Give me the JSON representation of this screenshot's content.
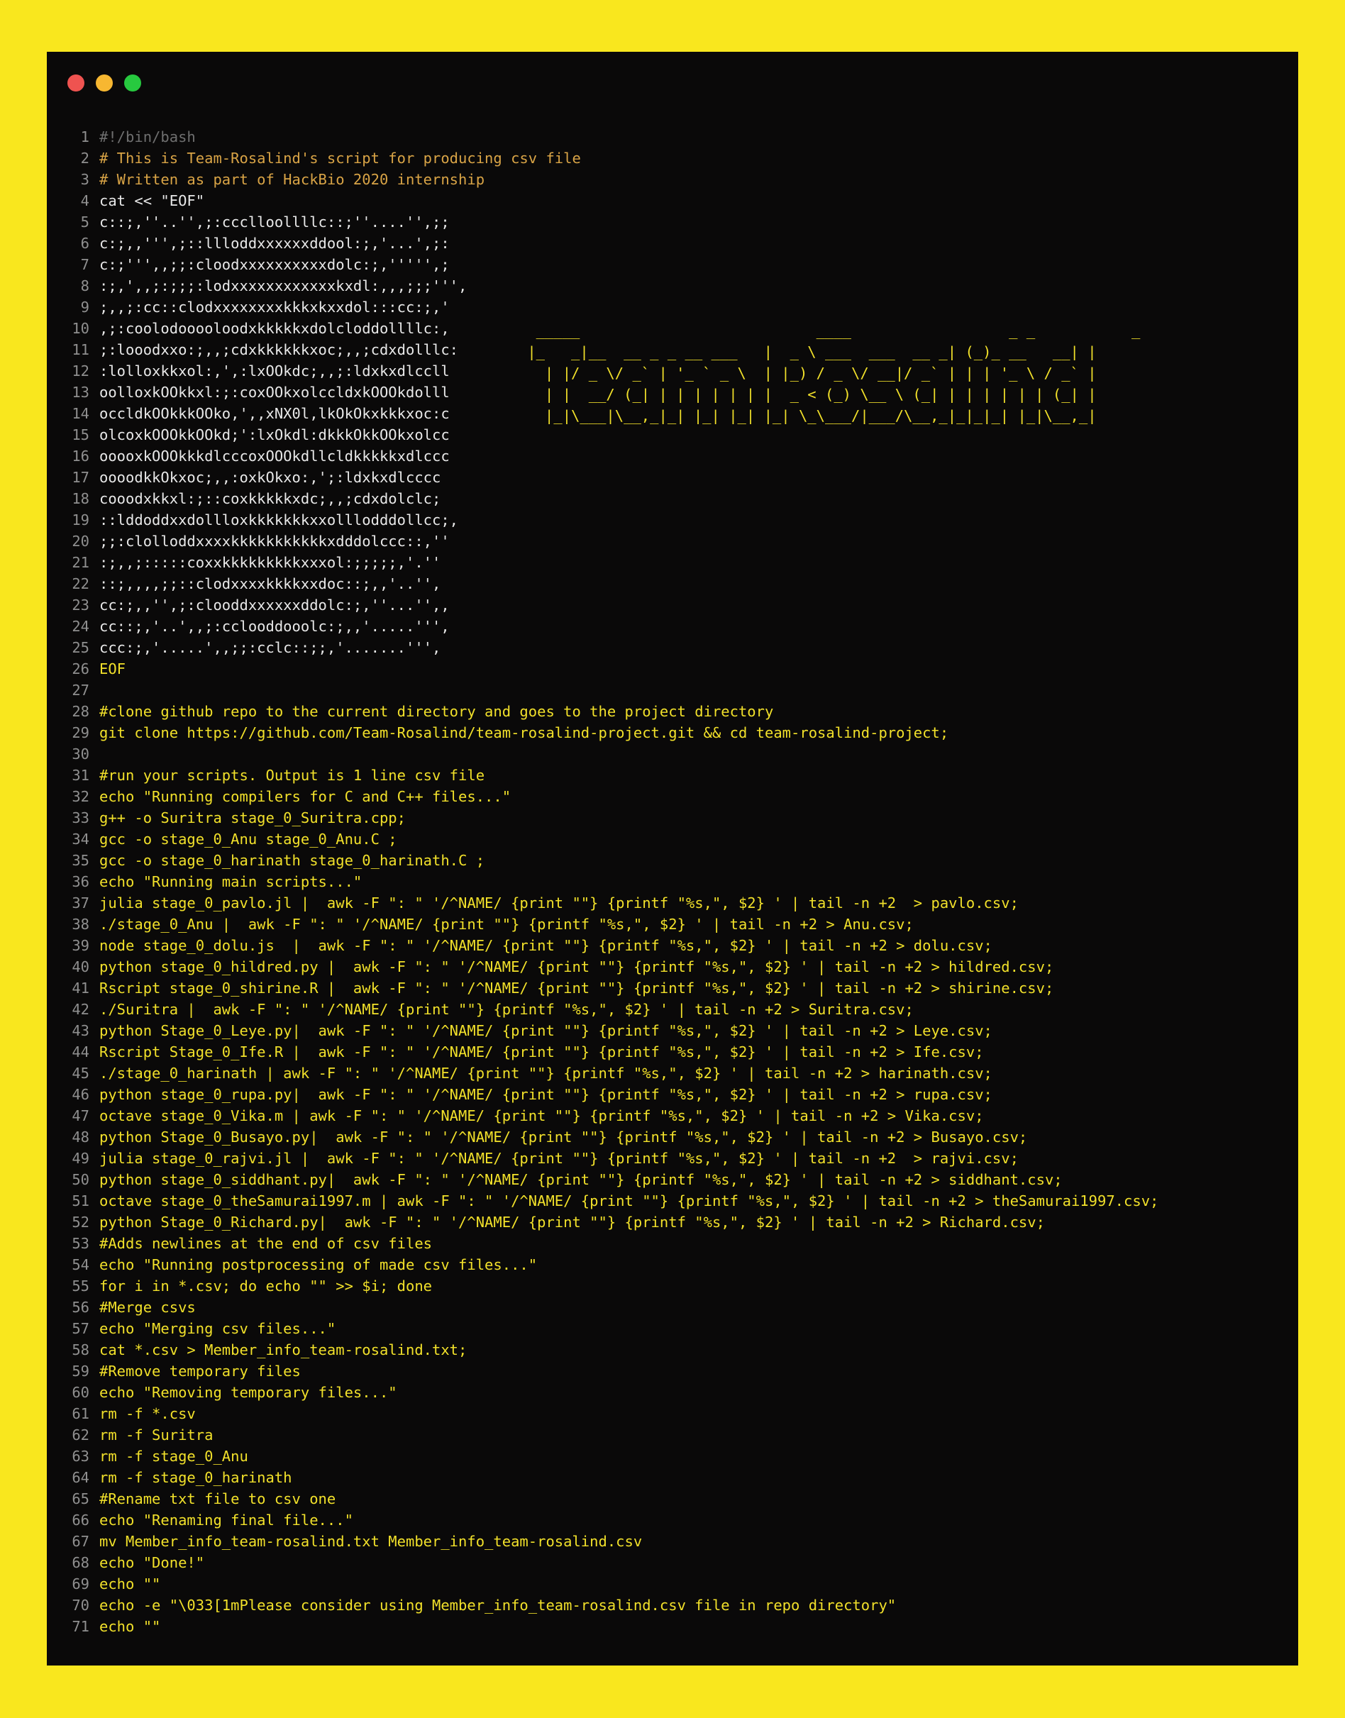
{
  "theme": {
    "background": "#f9e71e",
    "window_background": "#0a0909",
    "code_color": "#f1e02a",
    "comment_color": "#d9a446",
    "ascii_art_color": "#e8e8e8",
    "line_number_color": "#8f8f8f",
    "traffic_lights": [
      "#ef5350",
      "#f7b731",
      "#27c93f"
    ]
  },
  "banner_lines": [
    "  _____                           ____                  _ _           _",
    " |_   _|__  __ _ _ __ ___   |  _ \\ ___  ___  __ _| (_)_ __   __| |",
    "   | |/ _ \\/ _` | '_ ` _ \\  | |_) / _ \\/ __|/ _` | | | '_ \\ / _` |",
    "   | |  __/ (_| | | | | | | |  _ < (_) \\__ \\ (_| | | | | | | (_| |",
    "   |_|\\___|\\__,_|_| |_| |_| |_| \\_\\___/|___/\\__,_|_|_|_| |_|\\__,_|"
  ],
  "lines": [
    {
      "n": "1",
      "t": "#!/bin/bash",
      "s": "shebang"
    },
    {
      "n": "2",
      "t": "# This is Team-Rosalind's script for producing csv file",
      "s": "comment-orange"
    },
    {
      "n": "3",
      "t": "# Written as part of HackBio 2020 internship",
      "s": "comment-orange"
    },
    {
      "n": "4",
      "t": "cat << \"EOF\"",
      "s": "white"
    },
    {
      "n": "5",
      "t": "c::;,''..'',;:ccclloollllc::;''....'',;;",
      "s": "white"
    },
    {
      "n": "6",
      "t": "c:;,,''',;::llloddxxxxxxddool:;,'...',;:",
      "s": "white"
    },
    {
      "n": "7",
      "t": "c:;''',,;;:cloodxxxxxxxxxxdolc:;,''''',;",
      "s": "white"
    },
    {
      "n": "8",
      "t": ":;,',,;:;;;:lodxxxxxxxxxxxxkxdl:,,,;;;''',",
      "s": "white"
    },
    {
      "n": "9",
      "t": ";,,;:cc::clodxxxxxxxxkkkxkxxdol:::cc:;,'",
      "s": "white"
    },
    {
      "n": "10",
      "t": ",;:coolodooooloodxkkkkkxdolcloddollllc:,",
      "s": "white"
    },
    {
      "n": "11",
      "t": ";:looodxxo:;,,;cdxkkkkkkxoc;,,;cdxdolllc:",
      "s": "white"
    },
    {
      "n": "12",
      "t": ":lolloxkkxol:,',:lxOOkdc;,,;:ldxkxdlccll",
      "s": "white"
    },
    {
      "n": "13",
      "t": "oolloxkOOkkxl:;:coxOOkxolccldxkOOOkdolll",
      "s": "white"
    },
    {
      "n": "14",
      "t": "occldkOOkkkOOko,',,xNX0l,lkOkOkxkkkxoc:c",
      "s": "white"
    },
    {
      "n": "15",
      "t": "olcoxkOOOkkOOkd;':lxOkdl:dkkkOkkOOkxolcc",
      "s": "white"
    },
    {
      "n": "16",
      "t": "ooooxkOOOkkkdlcccoxOOOkdllcldkkkkkxdlccc",
      "s": "white"
    },
    {
      "n": "17",
      "t": "oooodkkOkxoc;,,:oxkOkxo:,';:ldxkxdlcccc",
      "s": "white"
    },
    {
      "n": "18",
      "t": "cooodxkkxl:;::coxkkkkkxdc;,,;cdxdolclc;",
      "s": "white"
    },
    {
      "n": "19",
      "t": "::lddoddxxdollloxkkkkkkkxxolllodddollcc;,",
      "s": "white"
    },
    {
      "n": "20",
      "t": ";;:clolloddxxxxkkkkkkkkkkkxdddolccc::,''",
      "s": "white"
    },
    {
      "n": "21",
      "t": ":;,,;:::::coxxkkkkkkkkkxxxol:;;;;;,'.''",
      "s": "white"
    },
    {
      "n": "22",
      "t": "::;,,,,;;::clodxxxxkkkkxxdoc::;,,'..'',",
      "s": "white"
    },
    {
      "n": "23",
      "t": "cc:;,,'',;:clooddxxxxxxddolc:;,''...'',,",
      "s": "white"
    },
    {
      "n": "24",
      "t": "cc::;,'..',,;:cclooddooolc:;,,'.....''',",
      "s": "white"
    },
    {
      "n": "25",
      "t": "ccc:;,'.....',,;;:cclc::;;,'.......''',",
      "s": "white"
    },
    {
      "n": "26",
      "t": "EOF",
      "s": ""
    },
    {
      "n": "27",
      "t": "",
      "s": ""
    },
    {
      "n": "28",
      "t": "#clone github repo to the current directory and goes to the project directory",
      "s": ""
    },
    {
      "n": "29",
      "t": "git clone https://github.com/Team-Rosalind/team-rosalind-project.git && cd team-rosalind-project;",
      "s": ""
    },
    {
      "n": "30",
      "t": "",
      "s": ""
    },
    {
      "n": "31",
      "t": "#run your scripts. Output is 1 line csv file",
      "s": ""
    },
    {
      "n": "32",
      "t": "echo \"Running compilers for C and C++ files...\"",
      "s": ""
    },
    {
      "n": "33",
      "t": "g++ -o Suritra stage_0_Suritra.cpp;",
      "s": ""
    },
    {
      "n": "34",
      "t": "gcc -o stage_0_Anu stage_0_Anu.C ;",
      "s": ""
    },
    {
      "n": "35",
      "t": "gcc -o stage_0_harinath stage_0_harinath.C ;",
      "s": ""
    },
    {
      "n": "36",
      "t": "echo \"Running main scripts...\"",
      "s": ""
    },
    {
      "n": "37",
      "t": "julia stage_0_pavlo.jl |  awk -F \": \" '/^NAME/ {print \"\"} {printf \"%s,\", $2} ' | tail -n +2  > pavlo.csv;",
      "s": ""
    },
    {
      "n": "38",
      "t": "./stage_0_Anu |  awk -F \": \" '/^NAME/ {print \"\"} {printf \"%s,\", $2} ' | tail -n +2 > Anu.csv;",
      "s": ""
    },
    {
      "n": "39",
      "t": "node stage_0_dolu.js  |  awk -F \": \" '/^NAME/ {print \"\"} {printf \"%s,\", $2} ' | tail -n +2 > dolu.csv;",
      "s": ""
    },
    {
      "n": "40",
      "t": "python stage_0_hildred.py |  awk -F \": \" '/^NAME/ {print \"\"} {printf \"%s,\", $2} ' | tail -n +2 > hildred.csv;",
      "s": ""
    },
    {
      "n": "41",
      "t": "Rscript stage_0_shirine.R |  awk -F \": \" '/^NAME/ {print \"\"} {printf \"%s,\", $2} ' | tail -n +2 > shirine.csv;",
      "s": ""
    },
    {
      "n": "42",
      "t": "./Suritra |  awk -F \": \" '/^NAME/ {print \"\"} {printf \"%s,\", $2} ' | tail -n +2 > Suritra.csv;",
      "s": ""
    },
    {
      "n": "43",
      "t": "python Stage_0_Leye.py|  awk -F \": \" '/^NAME/ {print \"\"} {printf \"%s,\", $2} ' | tail -n +2 > Leye.csv;",
      "s": ""
    },
    {
      "n": "44",
      "t": "Rscript Stage_0_Ife.R |  awk -F \": \" '/^NAME/ {print \"\"} {printf \"%s,\", $2} ' | tail -n +2 > Ife.csv;",
      "s": ""
    },
    {
      "n": "45",
      "t": "./stage_0_harinath | awk -F \": \" '/^NAME/ {print \"\"} {printf \"%s,\", $2} ' | tail -n +2 > harinath.csv;",
      "s": ""
    },
    {
      "n": "46",
      "t": "python stage_0_rupa.py|  awk -F \": \" '/^NAME/ {print \"\"} {printf \"%s,\", $2} ' | tail -n +2 > rupa.csv;",
      "s": ""
    },
    {
      "n": "47",
      "t": "octave stage_0_Vika.m | awk -F \": \" '/^NAME/ {print \"\"} {printf \"%s,\", $2} ' | tail -n +2 > Vika.csv;",
      "s": ""
    },
    {
      "n": "48",
      "t": "python Stage_0_Busayo.py|  awk -F \": \" '/^NAME/ {print \"\"} {printf \"%s,\", $2} ' | tail -n +2 > Busayo.csv;",
      "s": ""
    },
    {
      "n": "49",
      "t": "julia stage_0_rajvi.jl |  awk -F \": \" '/^NAME/ {print \"\"} {printf \"%s,\", $2} ' | tail -n +2  > rajvi.csv;",
      "s": ""
    },
    {
      "n": "50",
      "t": "python stage_0_siddhant.py|  awk -F \": \" '/^NAME/ {print \"\"} {printf \"%s,\", $2} ' | tail -n +2 > siddhant.csv;",
      "s": ""
    },
    {
      "n": "51",
      "t": "octave stage_0_theSamurai1997.m | awk -F \": \" '/^NAME/ {print \"\"} {printf \"%s,\", $2} ' | tail -n +2 > theSamurai1997.csv;",
      "s": ""
    },
    {
      "n": "52",
      "t": "python Stage_0_Richard.py|  awk -F \": \" '/^NAME/ {print \"\"} {printf \"%s,\", $2} ' | tail -n +2 > Richard.csv;",
      "s": ""
    },
    {
      "n": "53",
      "t": "#Adds newlines at the end of csv files",
      "s": ""
    },
    {
      "n": "54",
      "t": "echo \"Running postprocessing of made csv files...\"",
      "s": ""
    },
    {
      "n": "55",
      "t": "for i in *.csv; do echo \"\" >> $i; done",
      "s": ""
    },
    {
      "n": "56",
      "t": "#Merge csvs",
      "s": ""
    },
    {
      "n": "57",
      "t": "echo \"Merging csv files...\"",
      "s": ""
    },
    {
      "n": "58",
      "t": "cat *.csv > Member_info_team-rosalind.txt;",
      "s": ""
    },
    {
      "n": "59",
      "t": "#Remove temporary files",
      "s": ""
    },
    {
      "n": "60",
      "t": "echo \"Removing temporary files...\"",
      "s": ""
    },
    {
      "n": "61",
      "t": "rm -f *.csv",
      "s": ""
    },
    {
      "n": "62",
      "t": "rm -f Suritra",
      "s": ""
    },
    {
      "n": "63",
      "t": "rm -f stage_0_Anu",
      "s": ""
    },
    {
      "n": "64",
      "t": "rm -f stage_0_harinath",
      "s": ""
    },
    {
      "n": "65",
      "t": "#Rename txt file to csv one",
      "s": ""
    },
    {
      "n": "66",
      "t": "echo \"Renaming final file...\"",
      "s": ""
    },
    {
      "n": "67",
      "t": "mv Member_info_team-rosalind.txt Member_info_team-rosalind.csv",
      "s": ""
    },
    {
      "n": "68",
      "t": "echo \"Done!\"",
      "s": ""
    },
    {
      "n": "69",
      "t": "echo \"\"",
      "s": ""
    },
    {
      "n": "70",
      "t": "echo -e \"\\033[1mPlease consider using Member_info_team-rosalind.csv file in repo directory\"",
      "s": ""
    },
    {
      "n": "71",
      "t": "echo \"\"",
      "s": ""
    }
  ]
}
